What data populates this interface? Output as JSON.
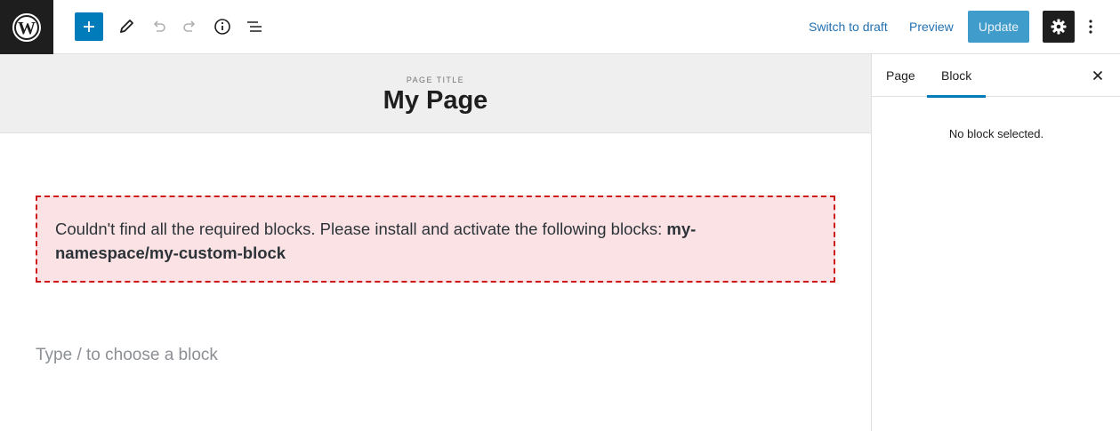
{
  "header": {
    "logo_icon": "wordpress-logo-icon",
    "inserter_icon": "plus-icon",
    "tools_icon": "pencil-icon",
    "undo_icon": "undo-icon",
    "redo_icon": "redo-icon",
    "info_icon": "info-icon",
    "list_view_icon": "list-view-icon",
    "switch_to_draft": "Switch to draft",
    "preview": "Preview",
    "update": "Update",
    "settings_icon": "gear-icon",
    "more_icon": "vertical-ellipsis-icon"
  },
  "editor": {
    "title_kicker": "PAGE TITLE",
    "title": "My Page",
    "missing_block_message": "Couldn't find all the required blocks. Please install and activate the following blocks: ",
    "missing_block_name": "my-namespace/my-custom-block",
    "placeholder": "Type / to choose a block"
  },
  "sidebar": {
    "tabs": [
      {
        "label": "Page",
        "active": false
      },
      {
        "label": "Block",
        "active": true
      }
    ],
    "close_icon": "close-icon",
    "empty_text": "No block selected."
  },
  "colors": {
    "accent": "#007cba",
    "dark": "#1e1e1e",
    "error_border": "#cc1818",
    "error_bg": "#fbe3e5",
    "link": "#2271b1"
  }
}
